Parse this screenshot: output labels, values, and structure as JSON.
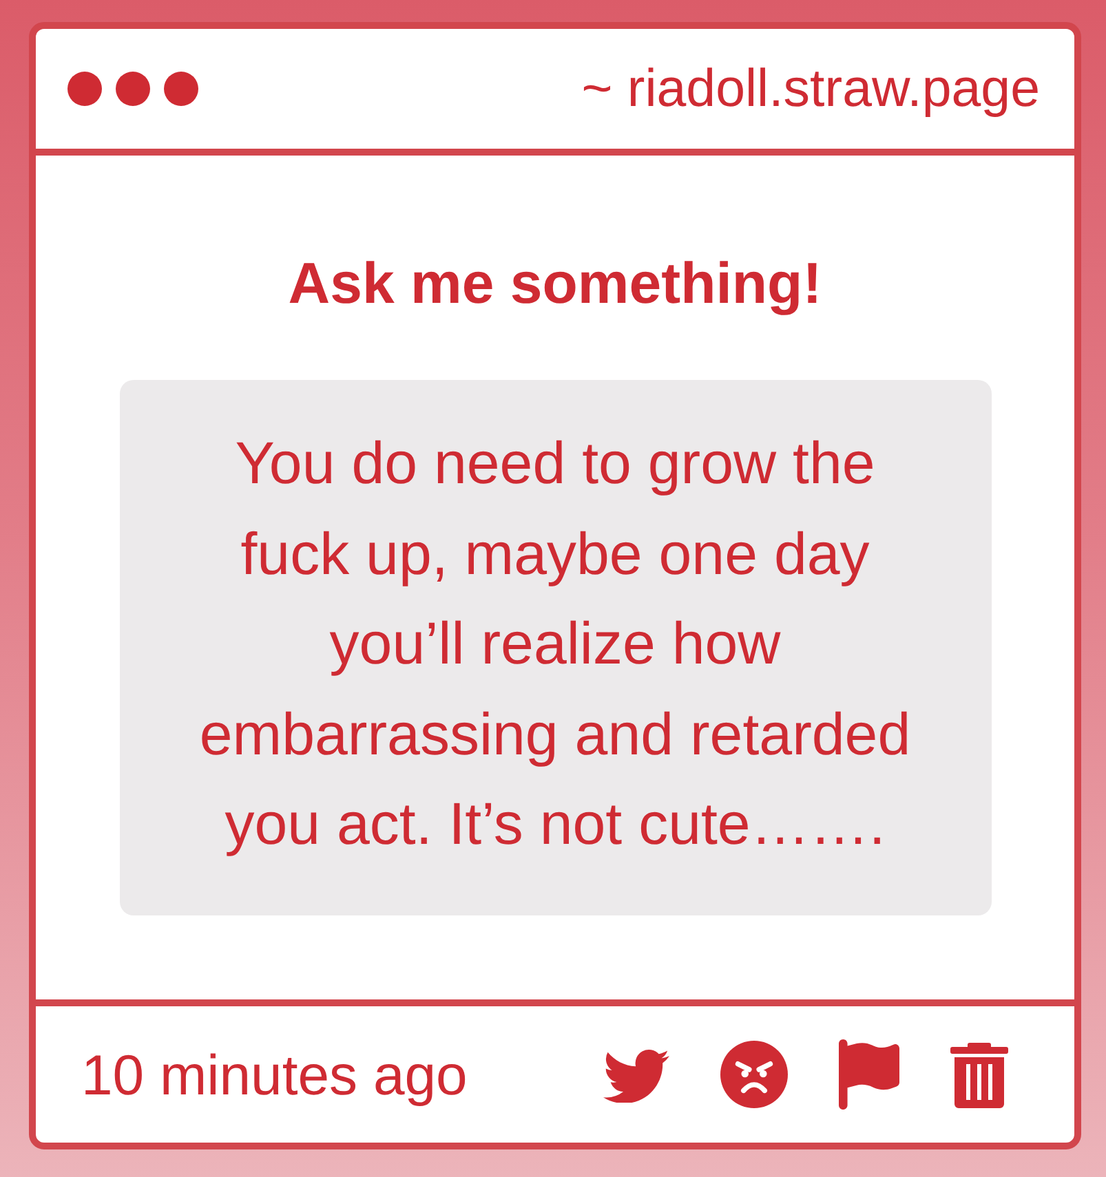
{
  "window": {
    "address": "~ riadoll.straw.page"
  },
  "prompt": {
    "title": "Ask me something!"
  },
  "question": {
    "text": "You do need to grow the fuck up, maybe one day you’ll realize how embarrassing and retarded you act. It’s not cute……."
  },
  "footer": {
    "time": "10 minutes ago",
    "actions": [
      {
        "kind": "tweet"
      },
      {
        "kind": "react"
      },
      {
        "kind": "report"
      },
      {
        "kind": "delete"
      }
    ]
  }
}
